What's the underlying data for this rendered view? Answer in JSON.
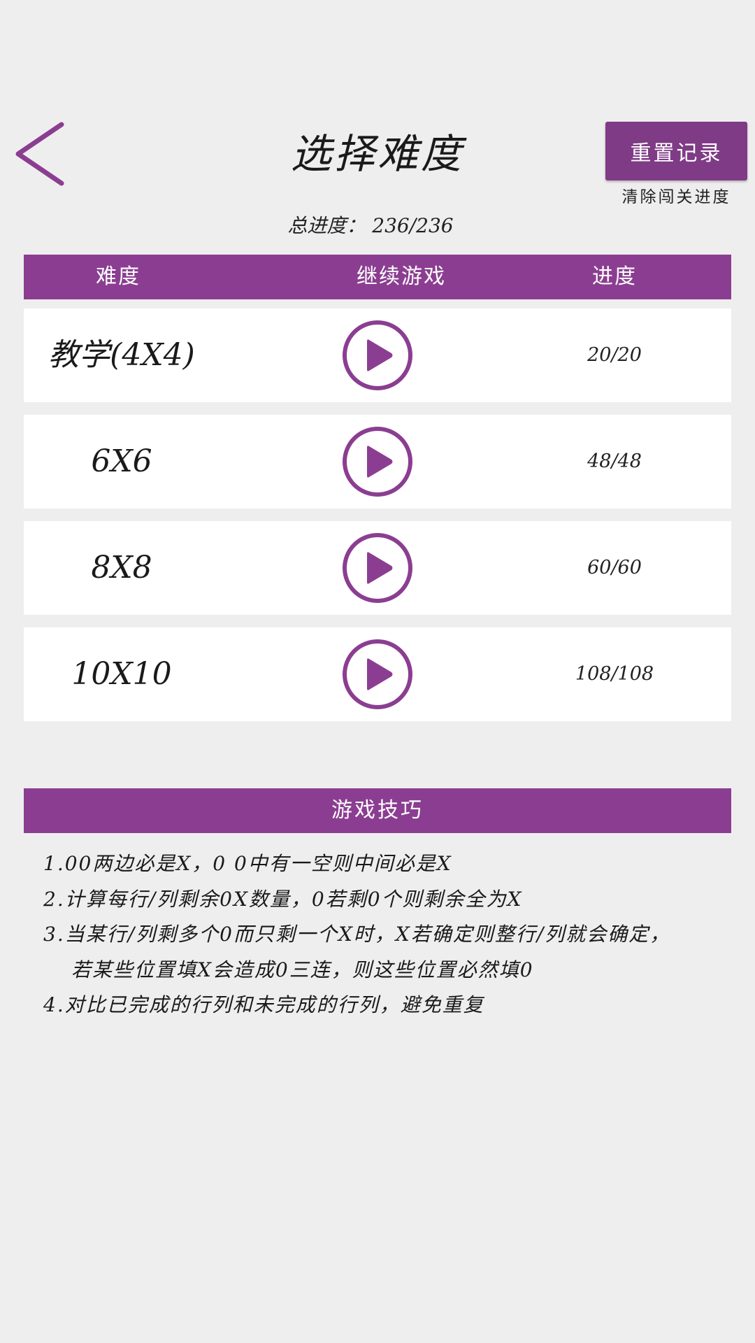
{
  "header": {
    "title": "选择难度",
    "reset_label": "重置记录",
    "reset_hint": "清除闯关进度",
    "total_progress": "总进度： 236/236"
  },
  "table": {
    "columns": [
      "难度",
      "继续游戏",
      "进度"
    ],
    "rows": [
      {
        "difficulty": "教学(4X4)",
        "progress": "20/20"
      },
      {
        "difficulty": "6X6",
        "progress": "48/48"
      },
      {
        "difficulty": "8X8",
        "progress": "60/60"
      },
      {
        "difficulty": "10X10",
        "progress": "108/108"
      }
    ]
  },
  "tips": {
    "title": "游戏技巧",
    "lines": [
      "1.00两边必是X，0 0中有一空则中间必是X",
      "2.计算每行/列剩余0X数量，0若剩0个则剩余全为X",
      "3.当某行/列剩多个0而只剩一个X时，X若确定则整行/列就会确定，",
      "若某些位置填X会造成0三连，则这些位置必然填0",
      "4.对比已完成的行列和未完成的行列，避免重复"
    ]
  },
  "colors": {
    "accent": "#8b3e91",
    "button": "#7f3b86",
    "background": "#efeeef"
  },
  "icons": {
    "back": "chevron-left-icon",
    "play": "play-circle-icon"
  }
}
